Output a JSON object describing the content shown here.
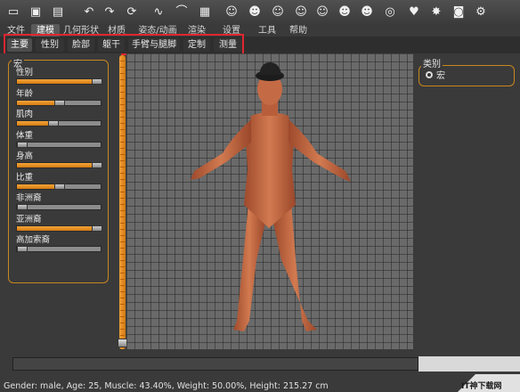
{
  "toolbar": {
    "buttons": [
      {
        "name": "new-icon",
        "glyph": "▭"
      },
      {
        "name": "save-icon",
        "glyph": "▣"
      },
      {
        "name": "load-icon",
        "glyph": "▤"
      },
      {
        "name": "undo-icon",
        "glyph": "↶"
      },
      {
        "name": "redo-icon",
        "glyph": "↷"
      },
      {
        "name": "reset-icon",
        "glyph": "⟳"
      },
      {
        "name": "smooth-icon",
        "glyph": "∿"
      },
      {
        "name": "wireframe-icon",
        "glyph": "⌒"
      },
      {
        "name": "checker-icon",
        "glyph": "▦"
      },
      {
        "name": "front-view-icon",
        "glyph": "☺"
      },
      {
        "name": "back-view-icon",
        "glyph": "☻"
      },
      {
        "name": "left-view-icon",
        "glyph": "☺"
      },
      {
        "name": "face-icon",
        "glyph": "☺"
      },
      {
        "name": "head-icon",
        "glyph": "☺"
      },
      {
        "name": "head-side-icon",
        "glyph": "☻"
      },
      {
        "name": "head-back-icon",
        "glyph": "☻"
      },
      {
        "name": "top-view-icon",
        "glyph": "◎"
      },
      {
        "name": "bottom-view-icon",
        "glyph": "♥"
      },
      {
        "name": "pose-icon",
        "glyph": "✸"
      },
      {
        "name": "screenshot-icon",
        "glyph": "◙"
      },
      {
        "name": "settings-icon",
        "glyph": "⚙"
      }
    ]
  },
  "menu": {
    "tabs": [
      "文件",
      "建模",
      "几何形状",
      "材质",
      "姿态/动画",
      "渲染",
      "设置",
      "工具",
      "帮助"
    ],
    "active": 1
  },
  "subtabs": {
    "items": [
      "主要",
      "性别",
      "脸部",
      "躯干",
      "手臂与腿脚",
      "定制",
      "测量"
    ],
    "active": 0
  },
  "left": {
    "group_title": "宏",
    "sliders": [
      {
        "label": "性别",
        "value": 1.0
      },
      {
        "label": "年龄",
        "value": 0.5
      },
      {
        "label": "肌肉",
        "value": 0.43
      },
      {
        "label": "体重",
        "value": 0.0
      },
      {
        "label": "身高",
        "value": 1.0
      },
      {
        "label": "比重",
        "value": 0.5
      },
      {
        "label": "非洲裔",
        "value": 0.0
      },
      {
        "label": "亚洲裔",
        "value": 1.0
      },
      {
        "label": "高加索裔",
        "value": 0.0
      }
    ]
  },
  "right": {
    "group_title": "类别",
    "radio_label": "宏"
  },
  "status": "Gender: male, Age: 25, Muscle: 43.40%, Weight: 50.00%, Height: 215.27 cm",
  "watermark": "IT神下载网",
  "colors": {
    "accent": "#e8952a",
    "highlight": "#e0262f",
    "skin": "#c56a44"
  }
}
